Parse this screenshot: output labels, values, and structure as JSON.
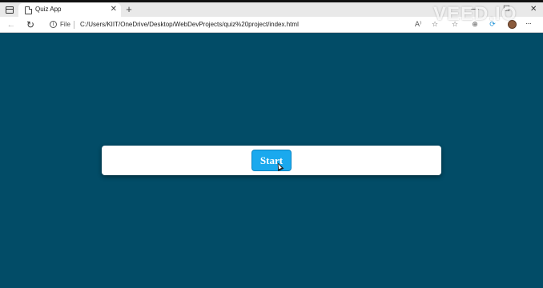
{
  "browser": {
    "tab": {
      "title": "Quiz App",
      "close_glyph": "✕",
      "favicon_icon": "file-icon"
    },
    "new_tab_glyph": "+",
    "window_controls": {
      "minimize": "—",
      "maximize": "☐",
      "close": "✕"
    },
    "toolbar": {
      "back_glyph": "←",
      "refresh_glyph": "↻",
      "info_glyph": "i",
      "file_label": "File",
      "url": "C:/Users/KIIT/OneDrive/Desktop/WebDevProjects/quiz%20project/index.html",
      "read_aloud_glyph": "A⁾",
      "extensions_glyph": "☆",
      "favorites_glyph": "☆",
      "collections_glyph": "⊕",
      "menu_glyph": "···"
    }
  },
  "page": {
    "background_color": "#024c67",
    "start_button_label": "Start",
    "start_button_color": "#1aa9ee"
  },
  "watermark": "VEED.IO"
}
